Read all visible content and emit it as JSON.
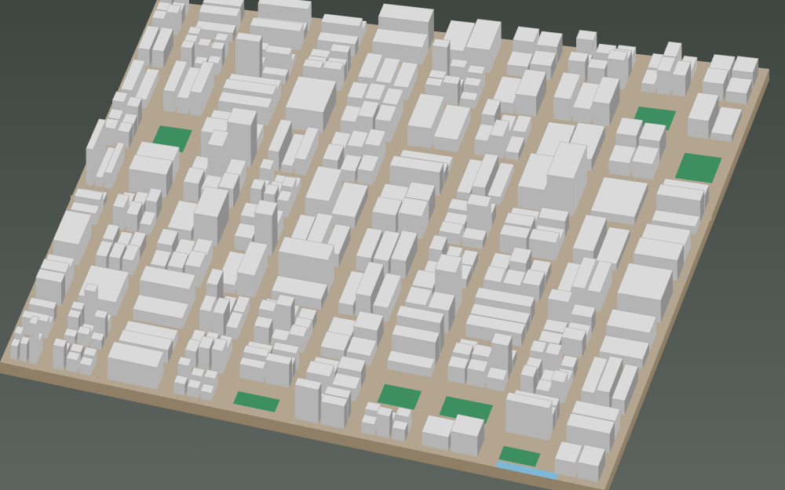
{
  "scene": {
    "kind": "3d-city-block-model",
    "view": "oblique-aerial",
    "colors": {
      "background_top": "#3f4541",
      "background_bottom": "#5d645f",
      "ground": "#a89880",
      "ground_side": "#8f7f67",
      "road": "#b3a58f",
      "building_top": "#dadada",
      "building_side": "#b4b4b4",
      "building_shadow": "#8e8e8e",
      "park": "#3d8f62",
      "water": "#7fb7d6"
    }
  }
}
